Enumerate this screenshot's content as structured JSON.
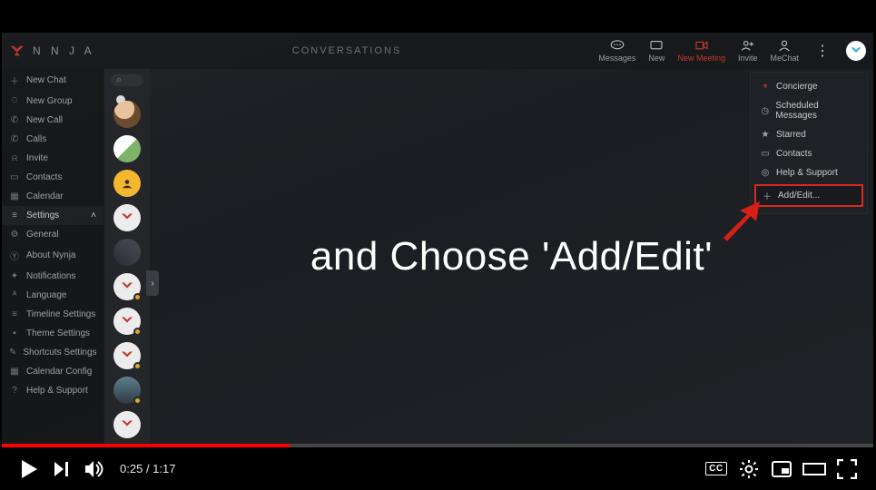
{
  "player": {
    "current_time": "0:25",
    "total_time": "1:17",
    "progress_percent": 33,
    "cc_label": "CC"
  },
  "app": {
    "brand": "N   N J A",
    "header_title": "CONVERSATIONS",
    "header_actions": {
      "messages": "Messages",
      "new": "New",
      "new_meeting": "New Meeting",
      "invite": "Invite",
      "mechat": "MeChat"
    },
    "sidebar": {
      "items": [
        {
          "icon": "＋",
          "label": "New Chat"
        },
        {
          "icon": "⊕",
          "label": "New Group"
        },
        {
          "icon": "✆",
          "label": "New Call"
        },
        {
          "icon": "✆",
          "label": "Calls"
        },
        {
          "icon": "⍾",
          "label": "Invite"
        },
        {
          "icon": "▭",
          "label": "Contacts"
        },
        {
          "icon": "▦",
          "label": "Calendar"
        }
      ],
      "settings_label": "Settings",
      "sub": [
        {
          "icon": "⚙",
          "label": "General"
        },
        {
          "icon": "Ⓨ",
          "label": "About Nynja"
        },
        {
          "icon": "✦",
          "label": "Notifications"
        },
        {
          "icon": "ᴬ",
          "label": "Language"
        },
        {
          "icon": "≡",
          "label": "Timeline Settings"
        },
        {
          "icon": "▪",
          "label": "Theme Settings"
        },
        {
          "icon": "✎",
          "label": "Shortcuts Settings"
        },
        {
          "icon": "▦",
          "label": "Calendar Config"
        },
        {
          "icon": "?",
          "label": "Help & Support"
        }
      ]
    },
    "dropdown": {
      "concierge": "Concierge",
      "scheduled": "Scheduled Messages",
      "starred": "Starred",
      "contacts": "Contacts",
      "help": "Help & Support",
      "add_edit": "Add/Edit..."
    },
    "caption": "and Choose 'Add/Edit'",
    "colors": {
      "accent": "#c0392b",
      "highlight": "#d82a22"
    }
  }
}
